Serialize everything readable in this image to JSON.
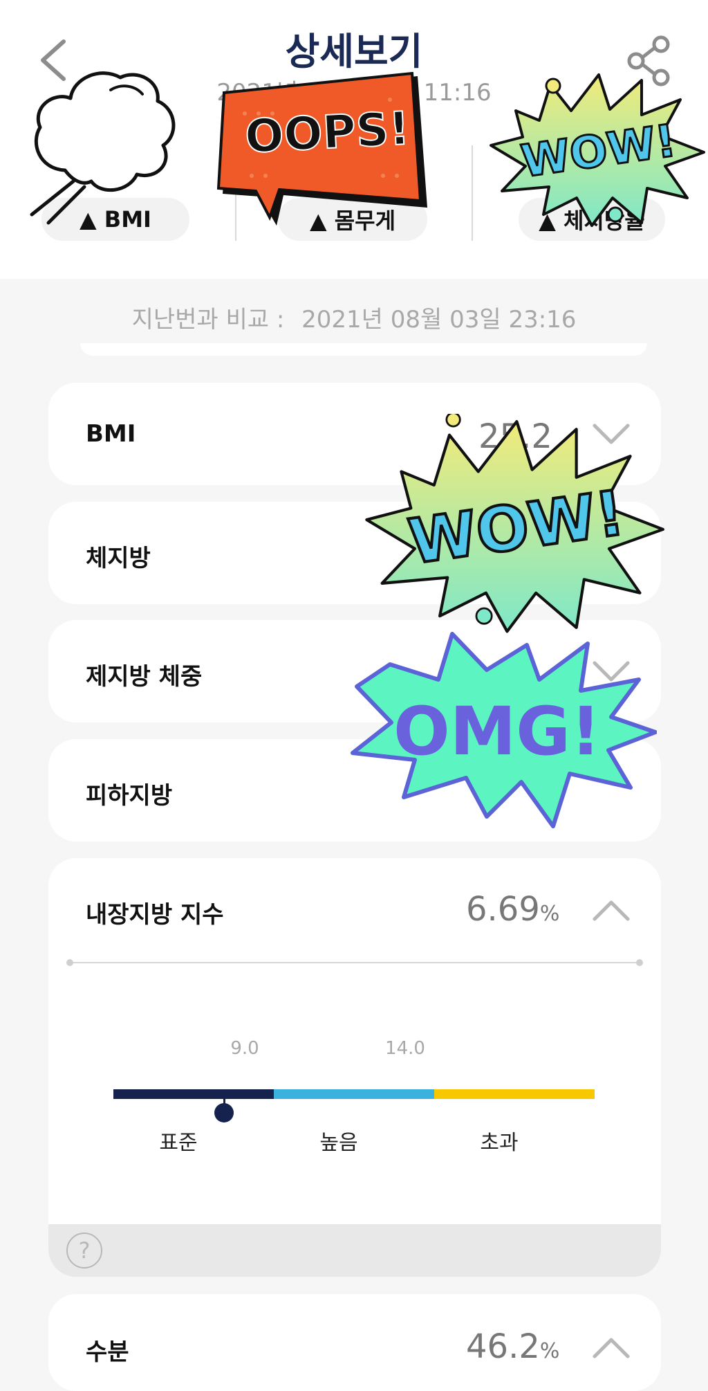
{
  "header": {
    "title": "상세보기",
    "date": "2021년 08월 04일 11:16",
    "tabs": [
      "▲ BMI",
      "▲ 몸무게",
      "▲ 체지방율"
    ]
  },
  "compare": {
    "label": "지난번과 비교 :",
    "date": "2021년 08월 03일 23:16"
  },
  "rows": [
    {
      "label": "BMI",
      "value": "25.2",
      "unit": ""
    },
    {
      "label": "체지방"
    },
    {
      "label": "제지방 체중"
    },
    {
      "label": "피하지방"
    }
  ],
  "visceral": {
    "label": "내장지방 지수",
    "value": "6.69",
    "unit": "%",
    "ticks": [
      "9.0",
      "14.0"
    ],
    "categories": [
      "표준",
      "높음",
      "초과"
    ],
    "indicator_fraction": 0.23,
    "colors": {
      "standard": "#15224e",
      "high": "#3bb2de",
      "over": "#f7c800"
    },
    "help": "?"
  },
  "water": {
    "label": "수분",
    "value": "46.2",
    "unit": "%"
  },
  "stickers": {
    "oops": "OOPS!",
    "wow": "WOW!",
    "omg": "OMG!"
  }
}
